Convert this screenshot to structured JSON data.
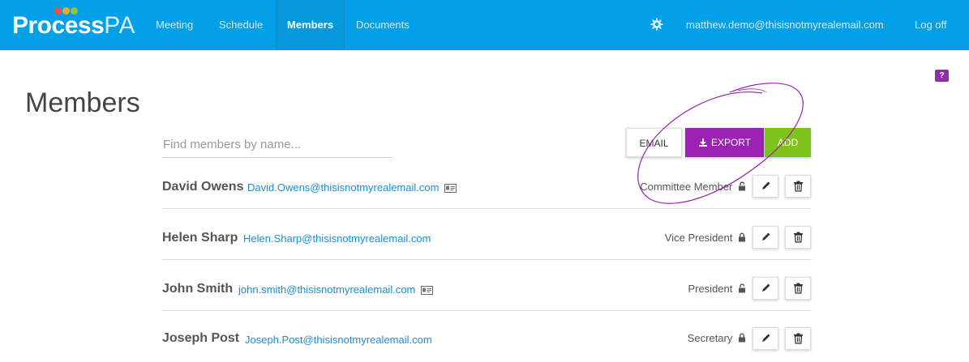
{
  "brand": {
    "name_bold": "Process",
    "name_light": "PA"
  },
  "nav": {
    "items": [
      {
        "label": "Meeting",
        "active": false
      },
      {
        "label": "Schedule",
        "active": false
      },
      {
        "label": "Members",
        "active": true
      },
      {
        "label": "Documents",
        "active": false
      }
    ],
    "user_email": "matthew.demo@thisisnotmyrealemail.com",
    "logoff_label": "Log off"
  },
  "help": {
    "label": "?"
  },
  "page": {
    "title": "Members"
  },
  "search": {
    "placeholder": "Find members by name..."
  },
  "actions": {
    "email_label": "EMAIL",
    "export_label": "EXPORT",
    "add_label": "ADD"
  },
  "members": [
    {
      "name": "David Owens",
      "email": "David.Owens@thisisnotmyrealemail.com",
      "has_card": true,
      "role": "Committee Member",
      "locked": false
    },
    {
      "name": "Helen Sharp",
      "email": "Helen.Sharp@thisisnotmyrealemail.com",
      "has_card": false,
      "role": "Vice President",
      "locked": true
    },
    {
      "name": "John Smith",
      "email": "john.smith@thisisnotmyrealemail.com",
      "has_card": true,
      "role": "President",
      "locked": false
    },
    {
      "name": "Joseph Post",
      "email": "Joseph.Post@thisisnotmyrealemail.com",
      "has_card": false,
      "role": "Secretary",
      "locked": true
    }
  ],
  "colors": {
    "navbar": "#03a0e8",
    "export": "#9b22b5",
    "add": "#7ec21c",
    "link": "#1a8fd0",
    "annotation": "#9b22b5"
  },
  "icons": {
    "settings": "gear-icon",
    "export": "export-icon",
    "edit": "pencil-icon",
    "delete": "trash-icon",
    "contact_card": "id-card-icon",
    "lock": "lock-icon"
  }
}
